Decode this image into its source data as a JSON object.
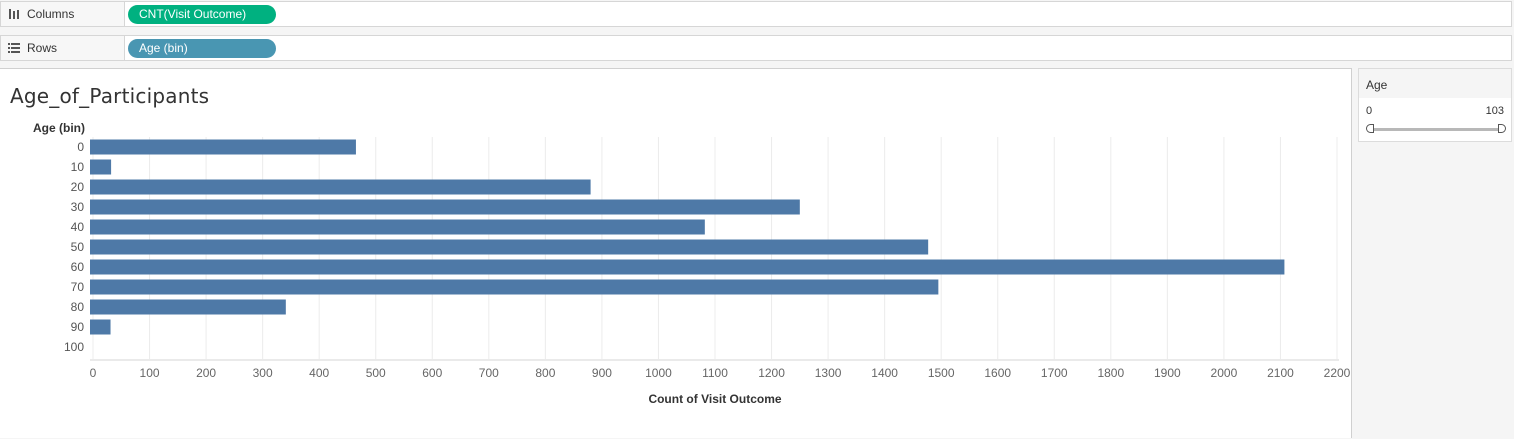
{
  "shelves": {
    "columns": {
      "label": "Columns",
      "pill": "CNT(Visit Outcome)",
      "icon": "columns-icon"
    },
    "rows": {
      "label": "Rows",
      "pill": "Age (bin)",
      "icon": "rows-icon"
    }
  },
  "sheet": {
    "title": "Age_of_Participants"
  },
  "filter": {
    "title": "Age",
    "min": "0",
    "max": "103"
  },
  "colors": {
    "bar": "#4e79a7",
    "grid": "#ececec",
    "pill_green": "#00b180",
    "pill_blue": "#4996b2"
  },
  "chart_data": {
    "type": "bar",
    "orientation": "horizontal",
    "title": "Age_of_Participants",
    "ylabel": "Age (bin)",
    "xlabel": "Count of Visit Outcome",
    "categories": [
      "0",
      "10",
      "20",
      "30",
      "40",
      "50",
      "60",
      "70",
      "80",
      "90",
      "100"
    ],
    "values": [
      465,
      32,
      880,
      1250,
      1082,
      1477,
      2107,
      1495,
      341,
      31,
      0
    ],
    "xlim": [
      0,
      2200
    ],
    "xticks": [
      "0",
      "100",
      "200",
      "300",
      "400",
      "500",
      "600",
      "700",
      "800",
      "900",
      "1000",
      "1100",
      "1200",
      "1300",
      "1400",
      "1500",
      "1600",
      "1700",
      "1800",
      "1900",
      "2000",
      "2100",
      "2200"
    ],
    "grid": true,
    "legend": "none"
  }
}
